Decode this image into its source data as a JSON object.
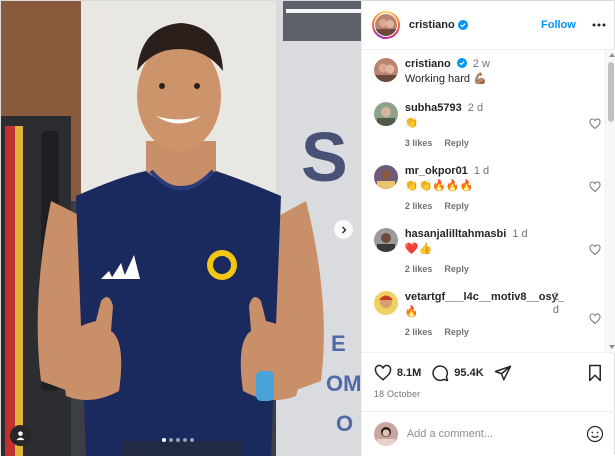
{
  "post": {
    "username": "cristiano",
    "follow_label": "Follow",
    "carousel": {
      "slides": 5,
      "active_slide": 1
    }
  },
  "caption": {
    "username": "cristiano",
    "time": "2 w",
    "text": "Working hard 💪🏽"
  },
  "comments": [
    {
      "username": "subha5793",
      "time": "2 d",
      "text": "👏",
      "likes": "3 likes",
      "reply": "Reply"
    },
    {
      "username": "mr_okpor01",
      "time": "1 d",
      "text": "👏👏🔥🔥🔥",
      "likes": "2 likes",
      "reply": "Reply"
    },
    {
      "username": "hasanjalilltahmasbi",
      "time": "1 d",
      "text": "❤️👍",
      "likes": "2 likes",
      "reply": "Reply"
    },
    {
      "username": "vetartgf___l4c__motiv8__osy_",
      "time": "2 d",
      "text": "🔥",
      "likes": "2 likes",
      "reply": "Reply"
    }
  ],
  "actions": {
    "likes_count": "8.1M",
    "comments_count": "95.4K",
    "date": "18 October"
  },
  "add_comment": {
    "placeholder": "Add a comment..."
  },
  "icons": {
    "like": "heart-icon",
    "comment": "comment-bubble-icon",
    "share": "paper-plane-icon",
    "save": "bookmark-icon",
    "more": "more-dots-icon",
    "verified": "verified-badge-icon",
    "next": "chevron-right-icon",
    "tag": "person-tag-icon",
    "emoji": "smiley-icon"
  },
  "colors": {
    "accent": "#0095f6",
    "verified": "#0095f6",
    "text": "#262626",
    "muted": "#737373",
    "jersey": "#1b2a5e"
  }
}
